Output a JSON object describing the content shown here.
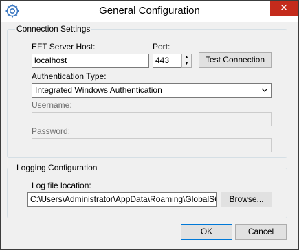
{
  "window": {
    "title": "General Configuration",
    "close_glyph": "✕",
    "icon": "gear-globe-icon"
  },
  "connection": {
    "legend": "Connection Settings",
    "host_label": "EFT Server Host:",
    "host_value": "localhost",
    "port_label": "Port:",
    "port_value": "443",
    "test_button": "Test Connection",
    "auth_label": "Authentication Type:",
    "auth_selected": "Integrated Windows Authentication",
    "username_label": "Username:",
    "username_value": "",
    "password_label": "Password:",
    "password_value": ""
  },
  "logging": {
    "legend": "Logging Configuration",
    "log_label": "Log file location:",
    "log_value": "C:\\Users\\Administrator\\AppData\\Roaming\\GlobalSCAPE",
    "browse_button": "Browse..."
  },
  "buttons": {
    "ok": "OK",
    "cancel": "Cancel"
  },
  "colors": {
    "close_bg": "#c42b1c",
    "default_border": "#0078d7",
    "group_border": "#d5dfe5"
  }
}
